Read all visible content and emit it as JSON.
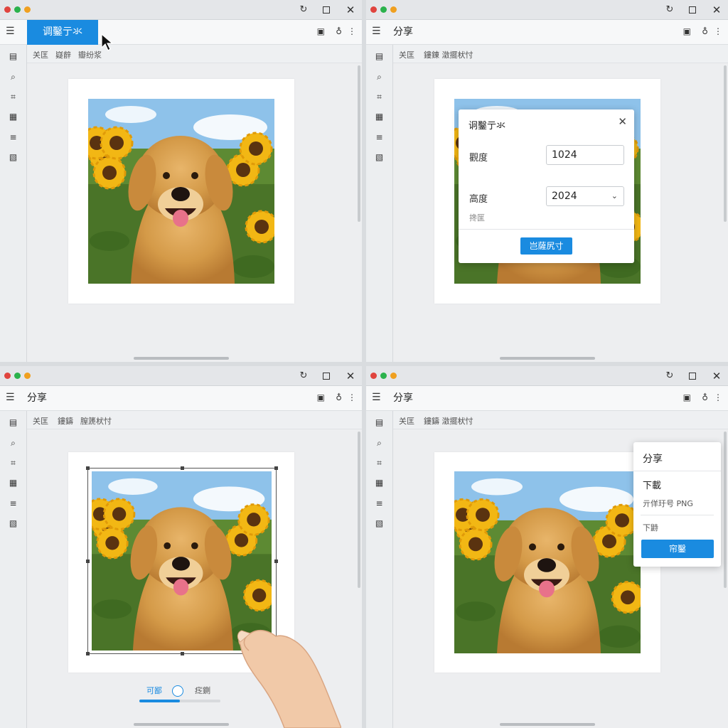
{
  "panel1": {
    "title": "调鑿亍氺",
    "sub": [
      "关匡",
      "嶷辪",
      "瓣纷浆"
    ]
  },
  "panel2": {
    "title": "分享",
    "sub": [
      "关匡",
      "鏤錬 澂擺枤忖"
    ],
    "dialog": {
      "title": "诇鑿亍氺",
      "width_label": "觀度",
      "width_value": "1024",
      "height_label": "高度",
      "height_value": "2024",
      "note": "搀匩",
      "button": "岂薩尻寸"
    }
  },
  "panel3": {
    "title": "分享",
    "sub": [
      "关匡",
      "鏤鑄",
      "膣篪枤忖"
    ],
    "slider": {
      "left_label": "可鄙",
      "right_label": "疺鍘",
      "fill": 0.5
    }
  },
  "panel4": {
    "title": "分享",
    "sub": [
      "关匡",
      "鏤鑄 澂擺枤忖"
    ],
    "share": {
      "title": "分享",
      "heading": "下載",
      "format": "亓佯玗号 PNG",
      "sub": "下鼭",
      "button": "帘鑿"
    }
  },
  "icons": {
    "menu": "list-icon",
    "refresh": "refresh-icon",
    "maximize": "maximize-icon",
    "close": "close-icon"
  },
  "colors": {
    "accent": "#1a8be0"
  }
}
